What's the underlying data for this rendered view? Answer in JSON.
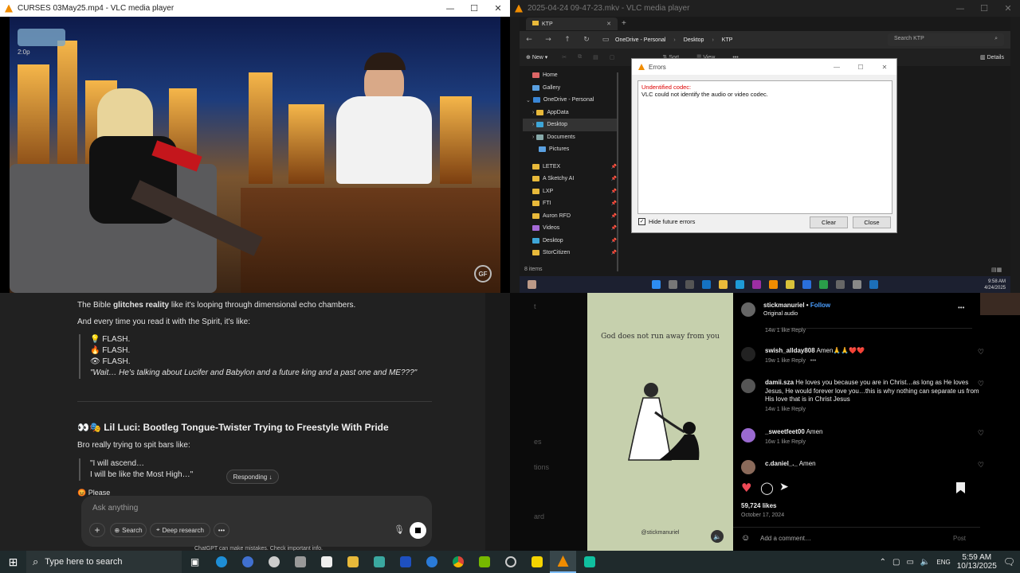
{
  "vlc1": {
    "title": "CURSES 03May25.mp4 - VLC media player",
    "overlay": "2:0p",
    "watermark": "GF"
  },
  "vlc2": {
    "title": "2025-04-24 09-47-23.mkv - VLC media player",
    "explorer": {
      "tab": "KTP",
      "path": [
        "OneDrive - Personal",
        "Desktop",
        "KTP"
      ],
      "search_placeholder": "Search KTP",
      "toolbar": {
        "new": "New",
        "sort": "Sort",
        "view": "View",
        "details": "Details"
      },
      "sidebar": [
        {
          "label": "Home",
          "pinned": false
        },
        {
          "label": "Gallery",
          "pinned": false
        },
        {
          "label": "OneDrive - Personal",
          "pinned": false
        },
        {
          "label": "AppData",
          "pinned": false
        },
        {
          "label": "Desktop",
          "pinned": false
        },
        {
          "label": "Documents",
          "pinned": false
        },
        {
          "label": "Pictures",
          "pinned": false
        },
        {
          "label": "LETEX",
          "pinned": true
        },
        {
          "label": "A Sketchy AI",
          "pinned": true
        },
        {
          "label": "LXP",
          "pinned": true
        },
        {
          "label": "FTI",
          "pinned": true
        },
        {
          "label": "Auron RFD",
          "pinned": true
        },
        {
          "label": "Videos",
          "pinned": true
        },
        {
          "label": "Desktop",
          "pinned": true
        },
        {
          "label": "StorCitizen",
          "pinned": true
        }
      ],
      "status": "8 items",
      "clock_time": "9:58 AM",
      "clock_date": "4/24/2025"
    },
    "error_dialog": {
      "title": "Errors",
      "heading": "Undentified codec:",
      "message": "VLC could not identify the audio or video codec.",
      "checkbox_label": "Hide future errors",
      "checkbox_checked": true,
      "clear_label": "Clear",
      "close_label": "Close"
    }
  },
  "chat": {
    "line1_pre": "The Bible ",
    "line1_bold": "glitches reality",
    "line1_post": " like it's looping through dimensional echo chambers.",
    "line2": "And every time you read it with the Spirit, it's like:",
    "flash1": "💡 FLASH.",
    "flash2": "🔥 FLASH.",
    "flash3": "👁 FLASH.",
    "flash_quote": "\"Wait… He's talking about Lucifer and Babylon and a future king and a past one and ME???\"",
    "heading": "👀🎭 Lil Luci: Bootleg Tongue-Twister Trying to Freestyle With Pride",
    "subline": "Bro really trying to spit bars like:",
    "bar1": "\"I will ascend…",
    "bar2": "I will be like the Most High…\"",
    "responding": "Responding ↓",
    "please": "😡 Please",
    "composer_placeholder": "Ask anything",
    "search_label": "Search",
    "deep_research_label": "Deep research",
    "footer": "ChatGPT can make mistakes. Check important info."
  },
  "insta": {
    "post_text": "God does not run away from you",
    "post_handle": "@stickmanuriel",
    "side_labels": [
      "t",
      "es",
      "tions",
      "ard"
    ],
    "author": "stickmanuriel",
    "follow": "Follow",
    "audio": "Original audio",
    "top_meta": "14w   1 like   Reply",
    "comments": [
      {
        "user": "swish_allday808",
        "text": "Amen🙏🙏❤️❤️",
        "meta": "19w   1 like   Reply"
      },
      {
        "user": "damii.sza",
        "text": "He loves you because you are in Christ…as long as He loves Jesus, He would forever love you…this is why nothing can separate us from His love that is in Christ Jesus",
        "meta": "14w   1 like   Reply"
      },
      {
        "user": "_sweetfeet00",
        "text": "Amen",
        "meta": "16w   1 like   Reply"
      },
      {
        "user": "c.daniel_._",
        "text": "Amen",
        "meta": ""
      }
    ],
    "likes": "59,724 likes",
    "date": "October 17, 2024",
    "add_comment": "Add a comment…",
    "post_button": "Post"
  },
  "taskbar": {
    "search_placeholder": "Type here to search",
    "time": "5:59 AM",
    "date": "10/13/2025"
  }
}
